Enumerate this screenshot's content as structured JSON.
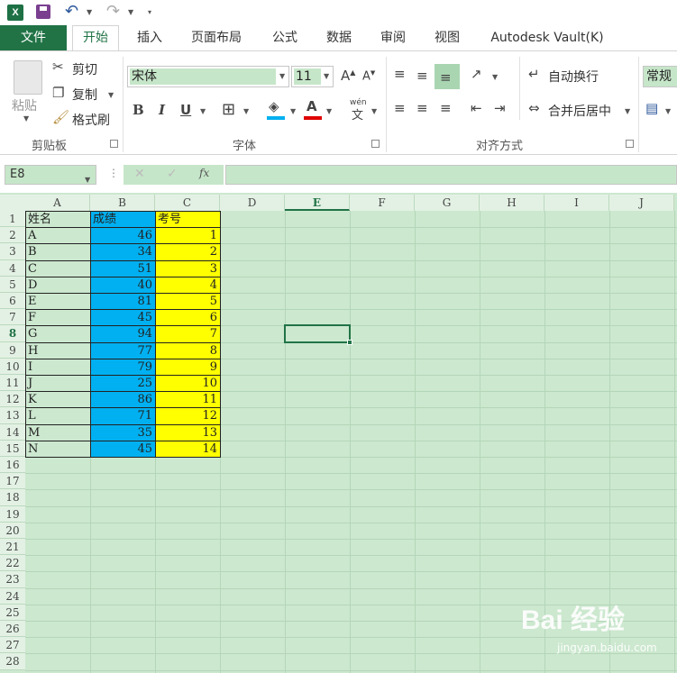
{
  "qat": {
    "app_icon": "X"
  },
  "tabs": [
    "文件",
    "开始",
    "插入",
    "页面布局",
    "公式",
    "数据",
    "审阅",
    "视图",
    "Autodesk Vault(K)"
  ],
  "ribbon": {
    "clipboard": {
      "paste": "粘贴",
      "cut": "剪切",
      "copy": "复制",
      "format_painter": "格式刷",
      "label": "剪贴板"
    },
    "font": {
      "name": "宋体",
      "size": "11",
      "bold": "B",
      "italic": "I",
      "underline": "U",
      "label": "字体",
      "phonetic": "wén"
    },
    "alignment": {
      "wrap": "自动换行",
      "merge": "合并后居中",
      "label": "对齐方式"
    },
    "number": {
      "format": "常规"
    }
  },
  "formula_bar": {
    "name_box": "E8",
    "fx": "fx",
    "formula": ""
  },
  "columns": [
    "A",
    "B",
    "C",
    "D",
    "E",
    "F",
    "G",
    "H",
    "I",
    "J"
  ],
  "rows": [
    "1",
    "2",
    "3",
    "4",
    "5",
    "6",
    "7",
    "8",
    "9",
    "10",
    "11",
    "12",
    "13",
    "14",
    "15",
    "16",
    "17",
    "18",
    "19",
    "20",
    "21",
    "22",
    "23",
    "24",
    "25",
    "26",
    "27",
    "28"
  ],
  "table": {
    "headers": [
      "姓名",
      "成绩",
      "考号"
    ],
    "rows": [
      [
        "A",
        "46",
        "1"
      ],
      [
        "B",
        "34",
        "2"
      ],
      [
        "C",
        "51",
        "3"
      ],
      [
        "D",
        "40",
        "4"
      ],
      [
        "E",
        "81",
        "5"
      ],
      [
        "F",
        "45",
        "6"
      ],
      [
        "G",
        "94",
        "7"
      ],
      [
        "H",
        "77",
        "8"
      ],
      [
        "I",
        "79",
        "9"
      ],
      [
        "J",
        "25",
        "10"
      ],
      [
        "K",
        "86",
        "11"
      ],
      [
        "L",
        "71",
        "12"
      ],
      [
        "M",
        "35",
        "13"
      ],
      [
        "N",
        "45",
        "14"
      ]
    ]
  },
  "watermark": {
    "brand": "Bai 经验",
    "url": "jingyan.baidu.com"
  },
  "colors": {
    "accent": "#217346",
    "score_fill": "#00b0f0",
    "id_fill": "#ffff00",
    "sheet_bg": "#cce8cf"
  }
}
